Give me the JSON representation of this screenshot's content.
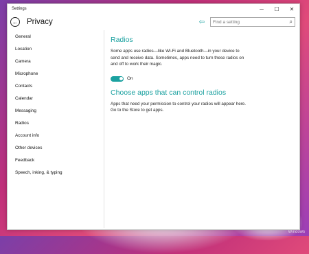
{
  "window": {
    "title": "Settings",
    "controls": {
      "minimize": "─",
      "maximize": "☐",
      "close": "✕"
    }
  },
  "header": {
    "title": "Privacy",
    "search_placeholder": "Find a setting"
  },
  "sidebar": {
    "items": [
      {
        "label": "General"
      },
      {
        "label": "Location"
      },
      {
        "label": "Camera"
      },
      {
        "label": "Microphone"
      },
      {
        "label": "Contacts"
      },
      {
        "label": "Calendar"
      },
      {
        "label": "Messaging"
      },
      {
        "label": "Radios"
      },
      {
        "label": "Account info"
      },
      {
        "label": "Other devices"
      },
      {
        "label": "Feedback"
      },
      {
        "label": "Speech, inking, & typing"
      }
    ]
  },
  "main": {
    "radios_title": "Radios",
    "radios_desc": "Some apps use radios—like Wi-Fi and Bluetooth—in your device to send and receive data. Sometimes, apps need to turn these radios on and off to work their magic.",
    "toggle_state": "On",
    "apps_title": "Choose apps that can control radios",
    "apps_desc": "Apps that need your permission to control your radios will appear here. Go to the Store to get apps."
  },
  "desktop": {
    "watermark": "Windows"
  },
  "colors": {
    "accent": "#1ba1a0"
  },
  "icons": {
    "back": "back-arrow-icon",
    "pin": "pin-icon",
    "search": "search-icon"
  }
}
